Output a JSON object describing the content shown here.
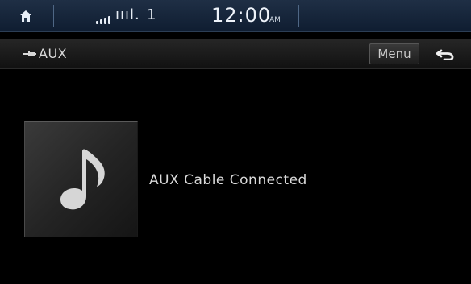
{
  "status_bar": {
    "home_icon": "home-icon",
    "signal_text": "ıııl.",
    "channel": "1",
    "time": "12:00",
    "am_pm": "AM"
  },
  "header": {
    "source_icon": "aux-cable-icon",
    "source_label": "AUX",
    "menu_label": "Menu",
    "back_icon": "back-arrow-icon"
  },
  "main": {
    "album_art_icon": "music-note-icon",
    "status_text": "AUX Cable Connected"
  },
  "colors": {
    "status_bar_top": "#1f2f45",
    "status_bar_bottom": "#0f1d31",
    "header_top": "#262626",
    "header_bottom": "#111111",
    "text": "#dadada",
    "background": "#000000"
  }
}
